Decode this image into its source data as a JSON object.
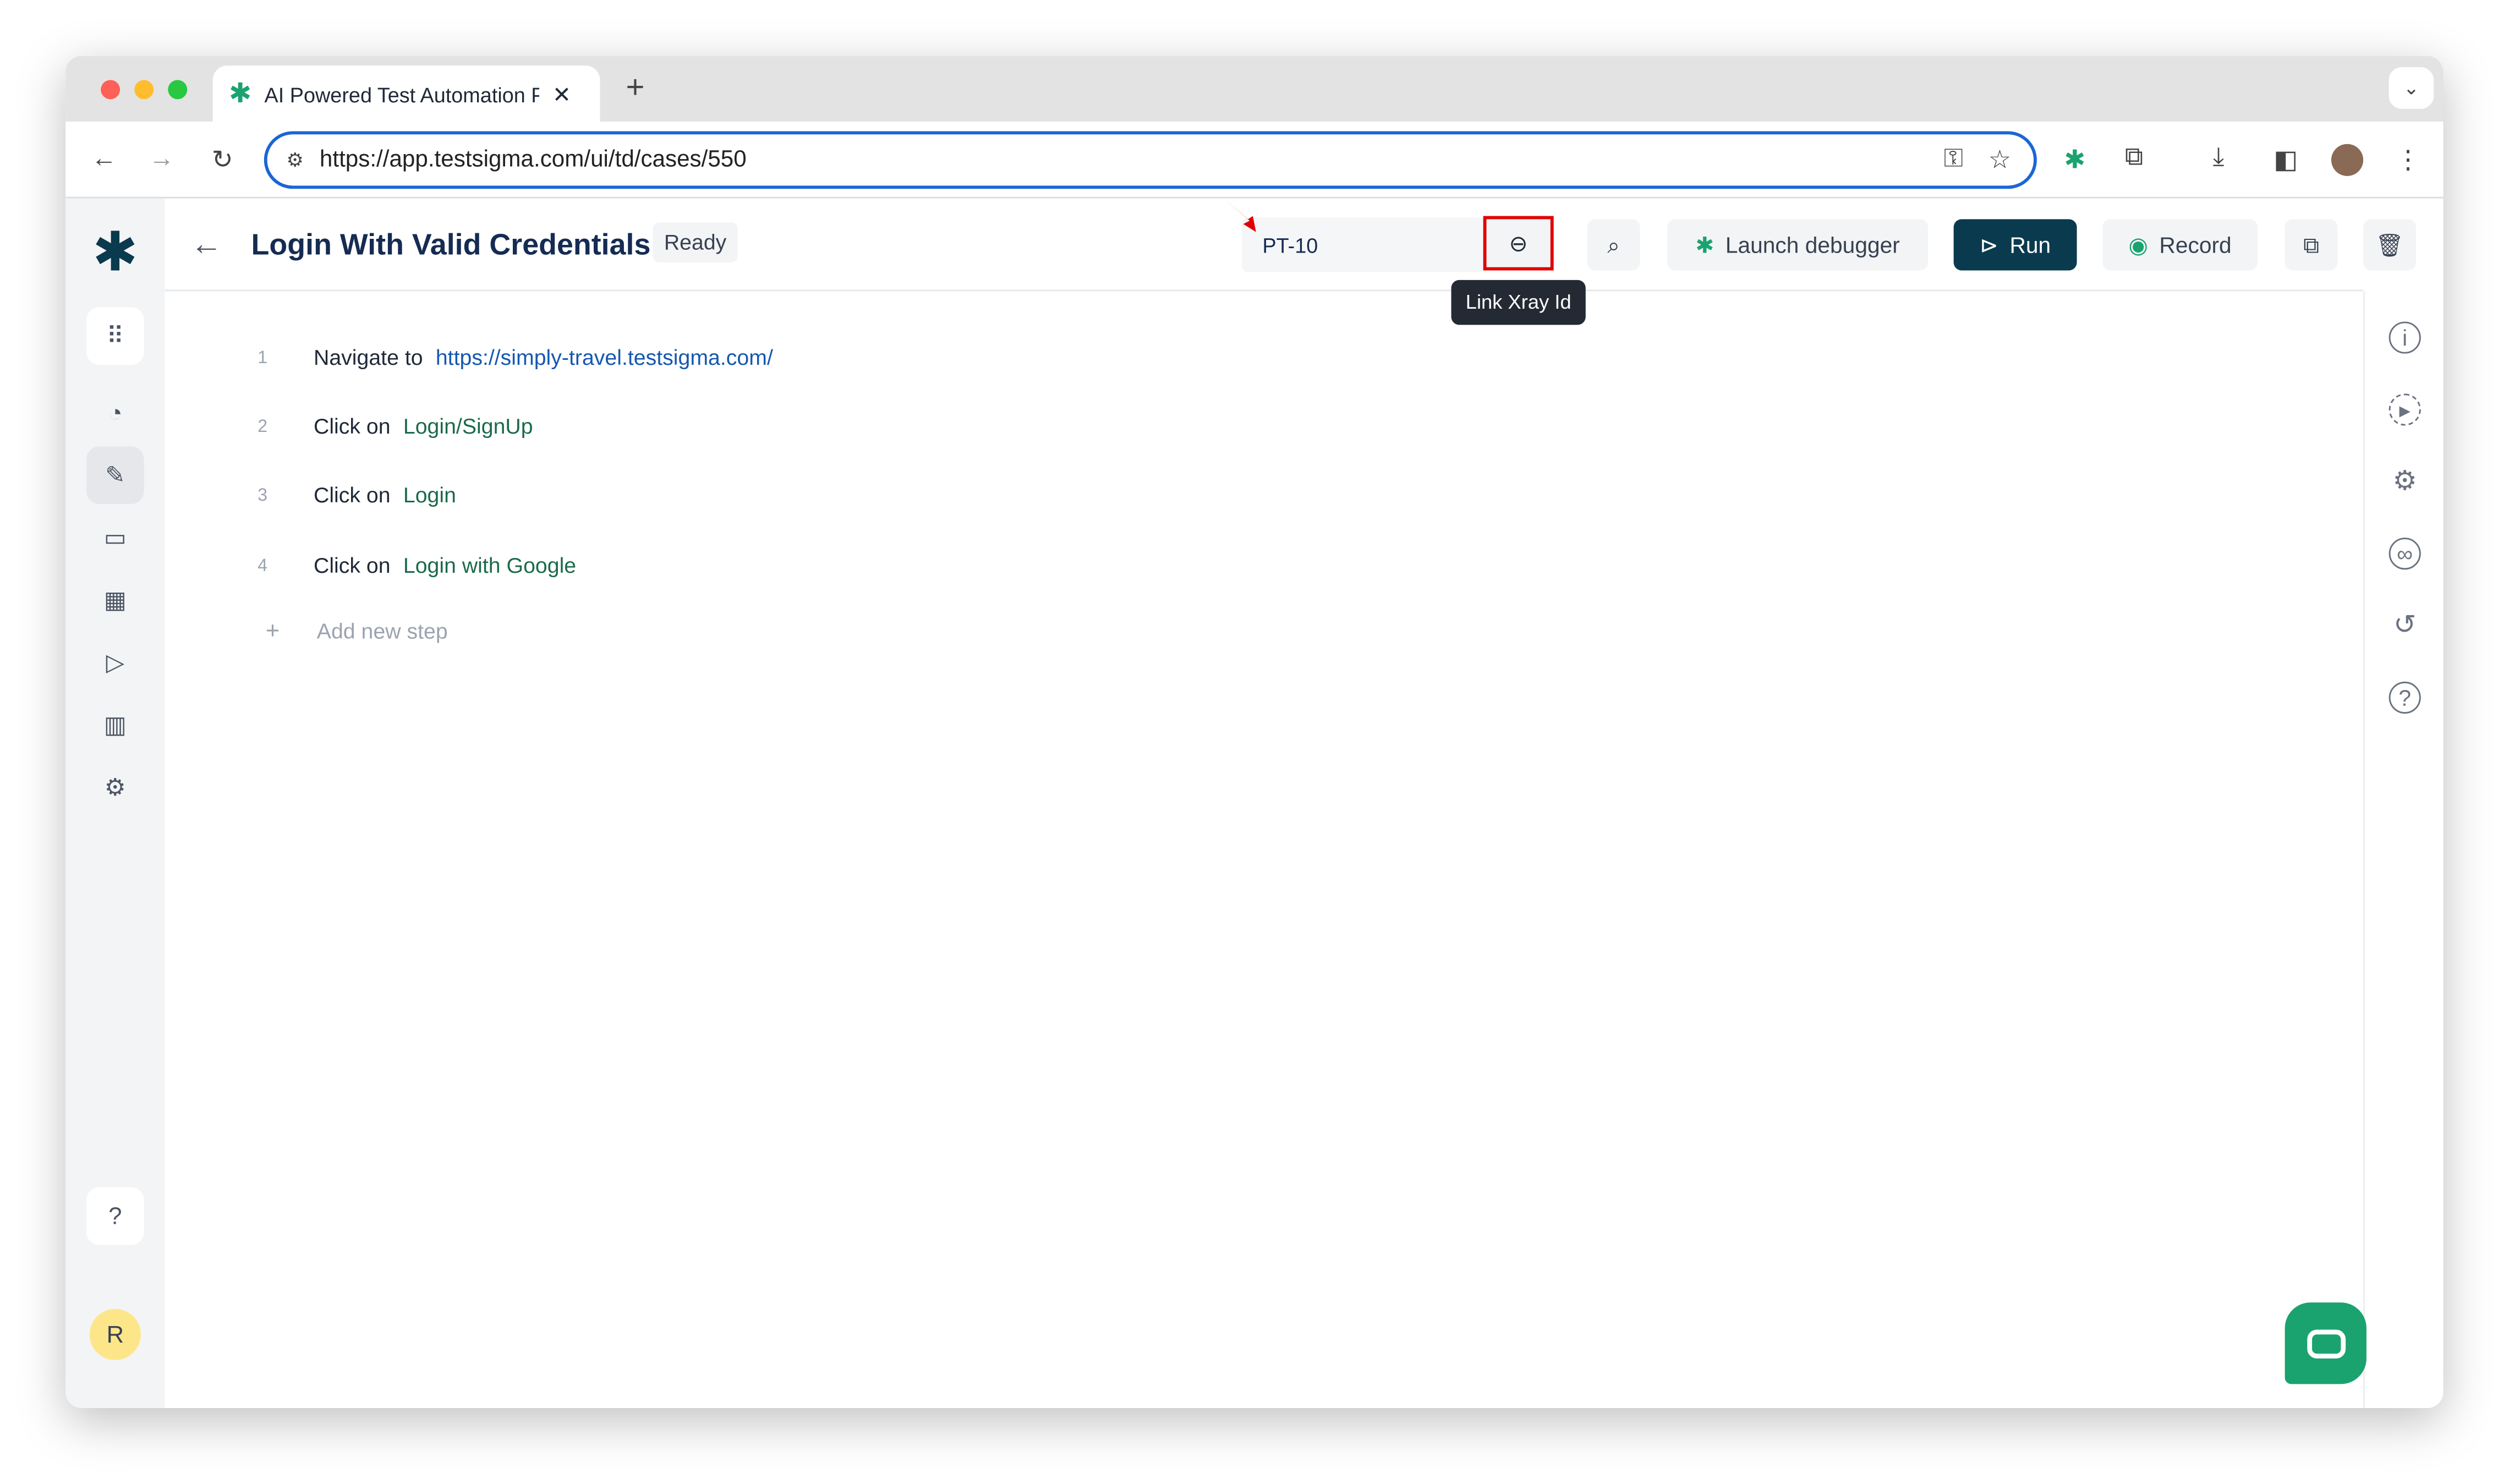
{
  "browser": {
    "tab_title": "AI Powered Test Automation P",
    "url": "https://app.testsigma.com/ui/td/cases/550"
  },
  "header": {
    "title": "Login With Valid Credentials",
    "status": "Ready",
    "xray_id": "PT-10",
    "link_tooltip": "Link Xray Id",
    "launch_debugger": "Launch debugger",
    "run": "Run",
    "record": "Record"
  },
  "steps": [
    {
      "num": "1",
      "action": "Navigate to",
      "target": "https://simply-travel.testsigma.com/"
    },
    {
      "num": "2",
      "action": "Click on",
      "target": "Login/SignUp"
    },
    {
      "num": "3",
      "action": "Click on",
      "target": "Login"
    },
    {
      "num": "4",
      "action": "Click on",
      "target": "Login with Google"
    }
  ],
  "add_step": "Add new step",
  "user": {
    "initial": "R"
  },
  "colors": {
    "primary": "#0a3a4e",
    "accent": "#1aa36f",
    "highlight": "#e00000",
    "url_border": "#1a66d6"
  }
}
